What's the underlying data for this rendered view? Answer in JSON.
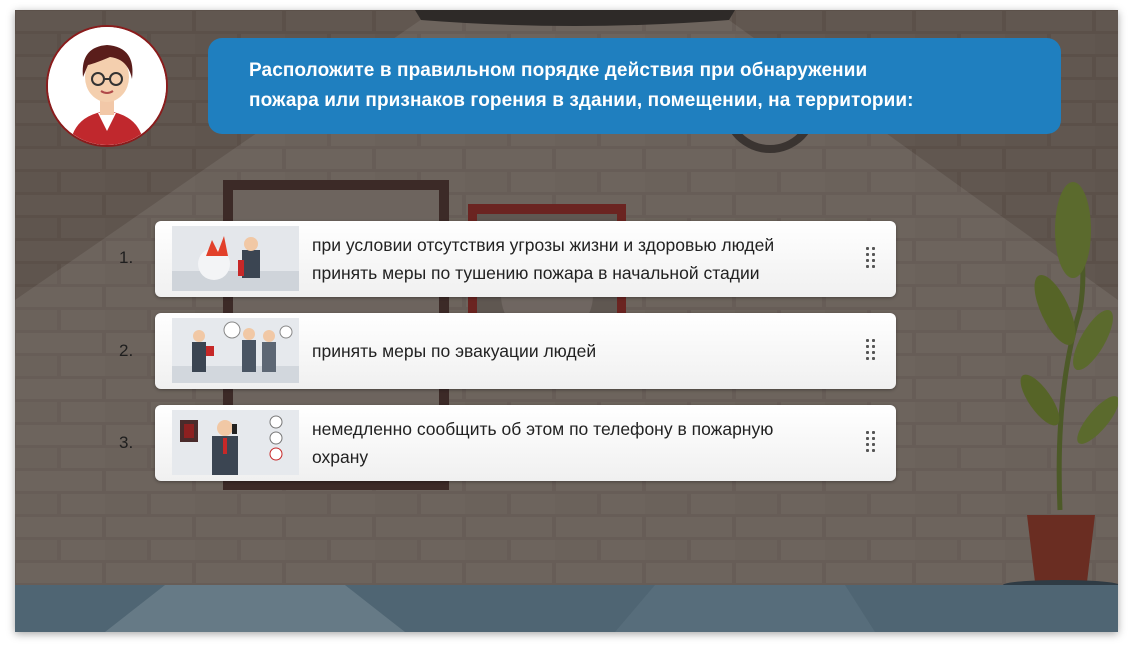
{
  "question": {
    "line1": "Расположите в правильном порядке действия при обнаружении",
    "line2": "пожара или признаков горения в здании, помещении, на территории:"
  },
  "items": [
    {
      "number": "1.",
      "line1": "при условии отсутствия угрозы жизни и здоровью людей",
      "line2": "принять меры по тушению пожара в начальной стадии",
      "icon": "fire-extinguisher-illustration"
    },
    {
      "number": "2.",
      "line1": "принять меры по эвакуации людей",
      "line2": "",
      "icon": "evacuation-illustration"
    },
    {
      "number": "3.",
      "line1": "немедленно сообщить об этом по телефону в пожарную",
      "line2": "охрану",
      "icon": "phone-call-illustration"
    }
  ],
  "colors": {
    "banner": "#1f7fbf",
    "wall": "#5a5049",
    "floor": "#4f6573",
    "avatar_border": "#8a1c1c"
  }
}
